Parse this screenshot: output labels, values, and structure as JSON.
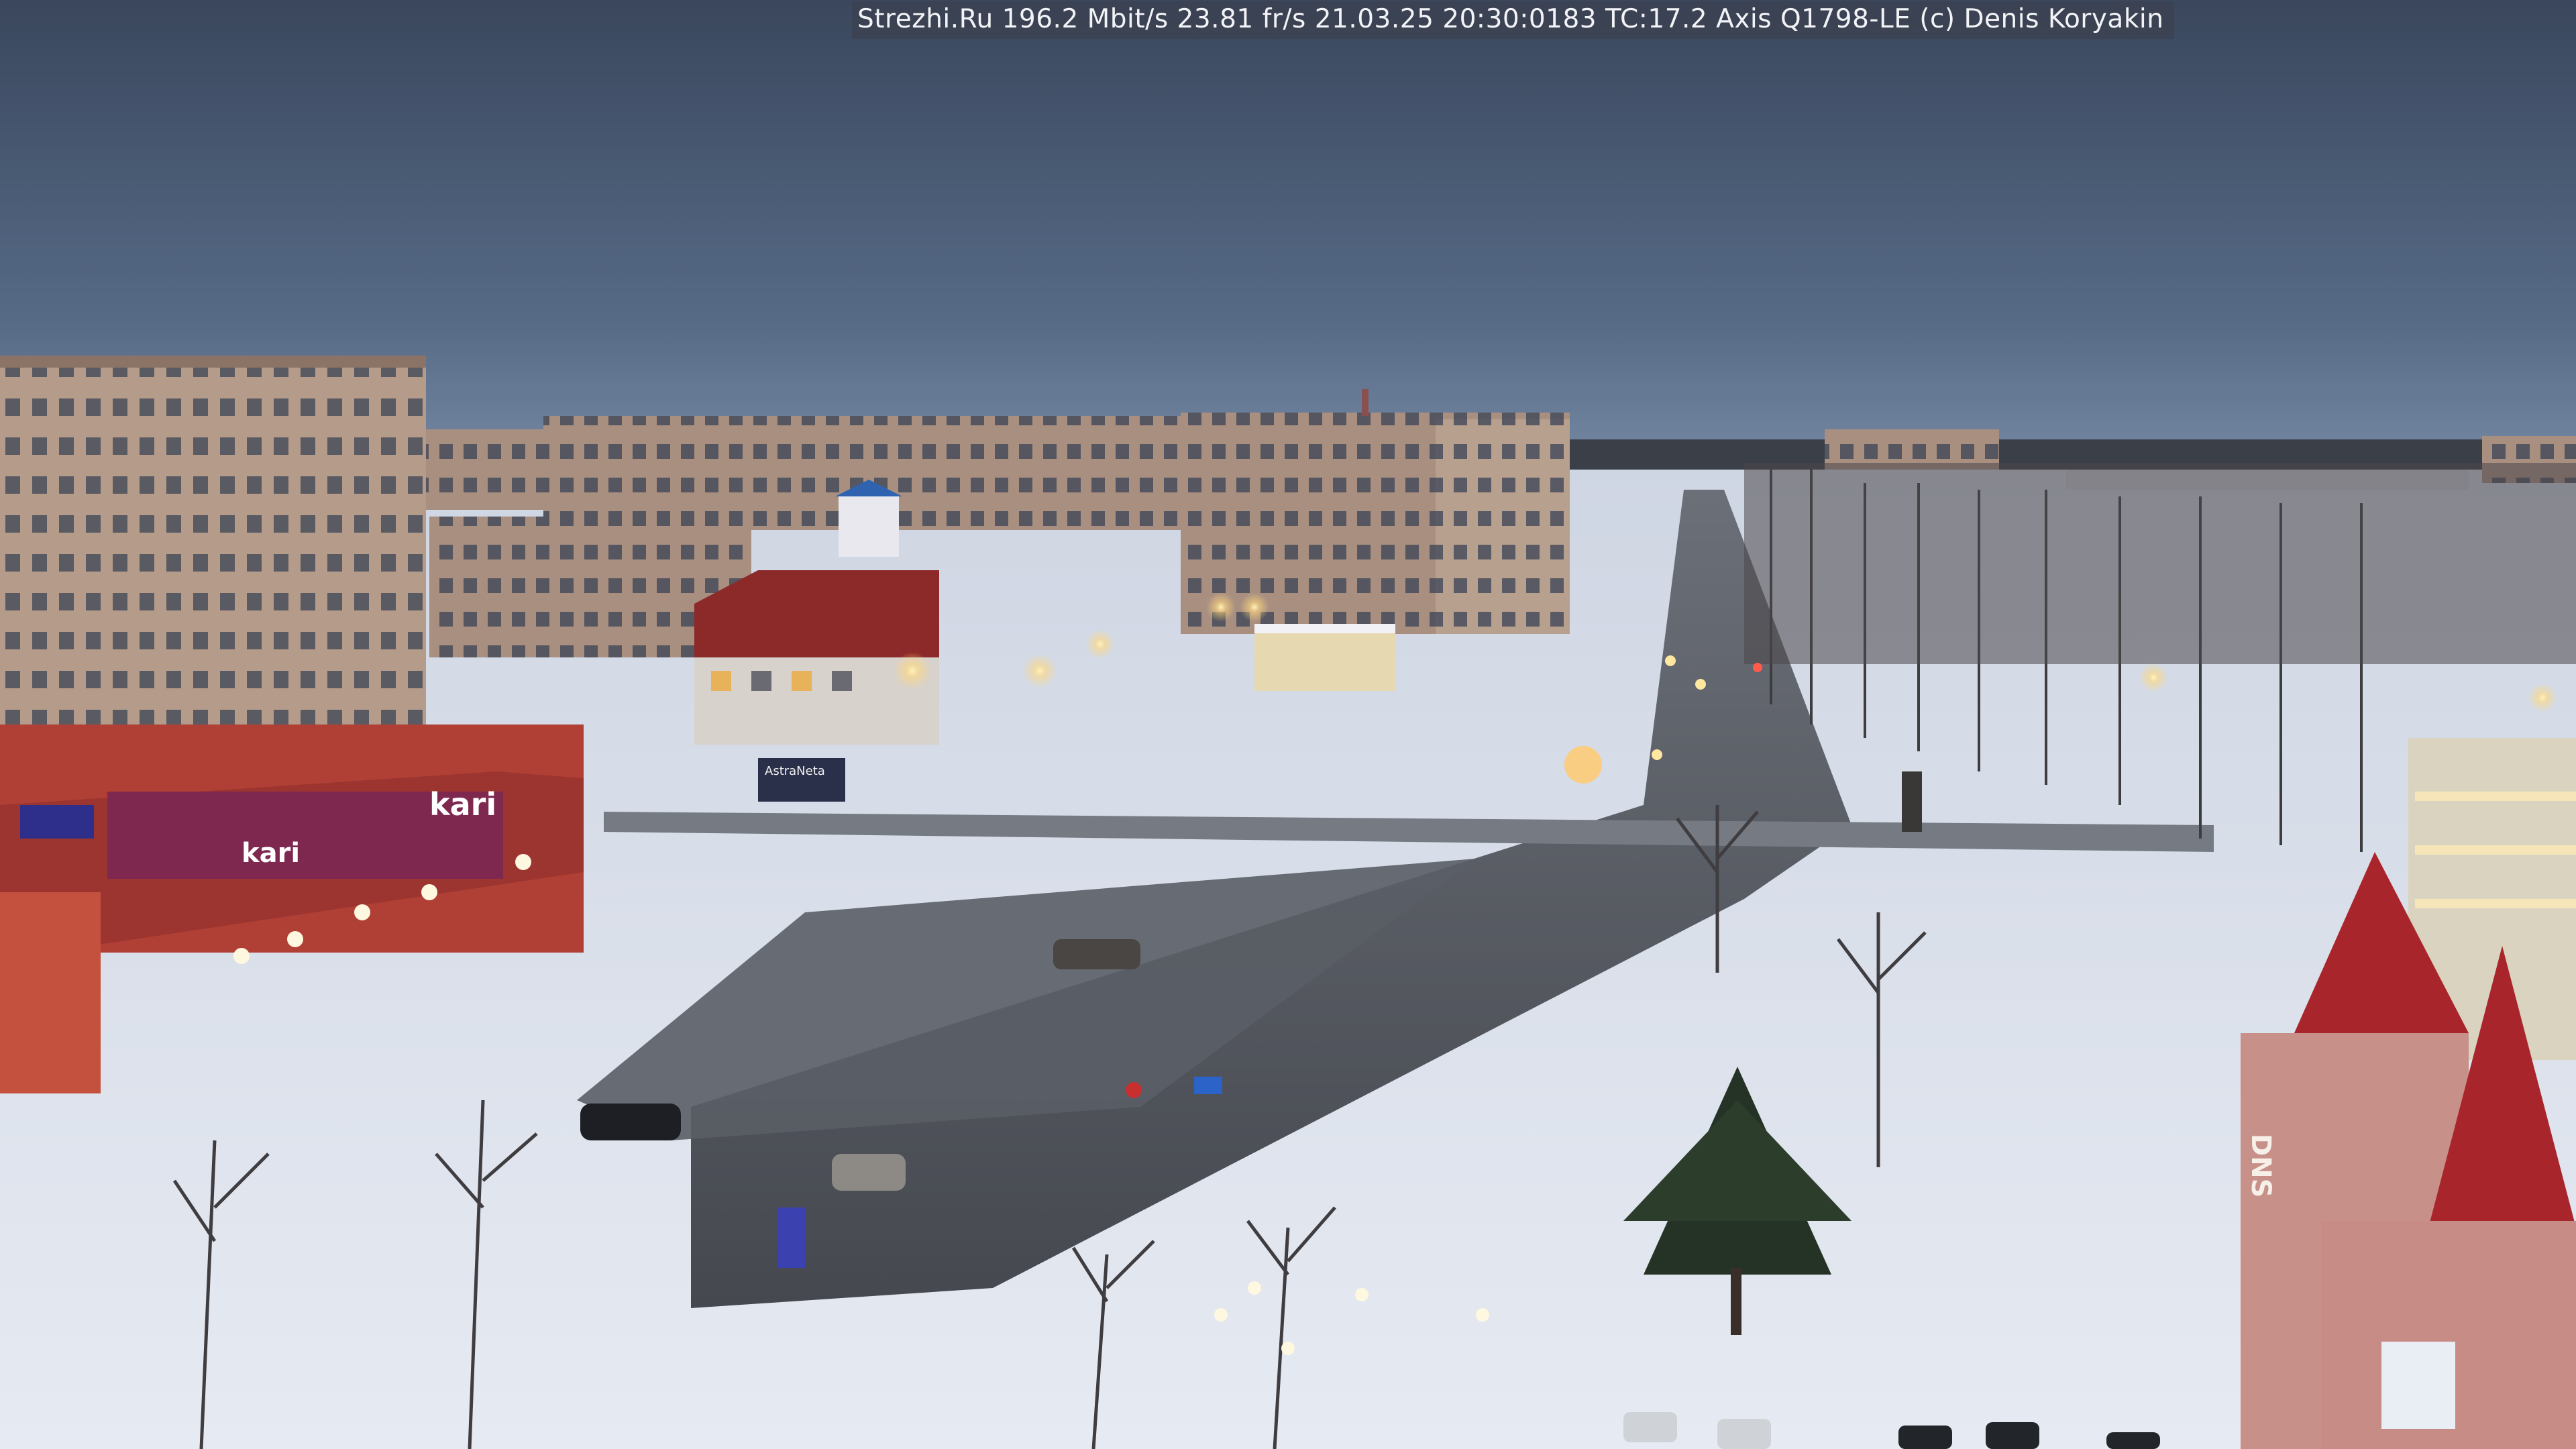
{
  "camera_overlay": {
    "site": "Strezhi.Ru",
    "bitrate": "196.2 Mbit/s",
    "framerate": "23.81 fr/s",
    "date": "21.03.25",
    "time": "20:30:0183",
    "tc": "TC:17.2",
    "camera_model": "Axis Q1798-LE",
    "copyright": "(c) Denis Koryakin"
  },
  "signage": {
    "store_sign": "kari",
    "billboard": "AstraNeta",
    "building_sign": "DNS"
  },
  "colors": {
    "sky_top": "#3c4a60",
    "sky_horizon": "#6a7d98",
    "snow": "#dfe4ee",
    "road": "#4c5058",
    "brick_red": "#b04035",
    "panel_building": "#b49a88"
  }
}
